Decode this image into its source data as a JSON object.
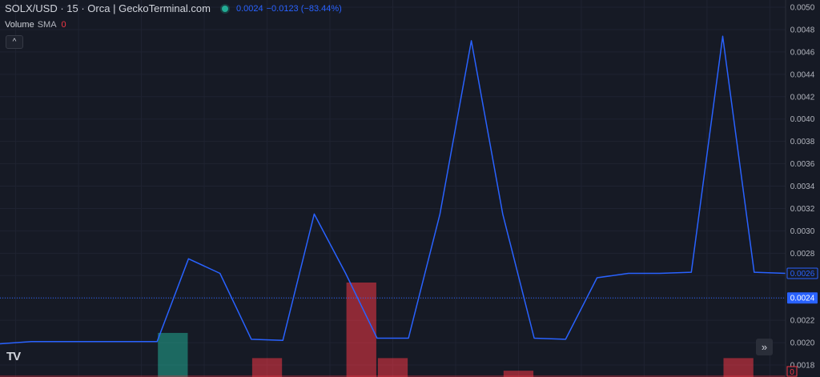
{
  "legend": {
    "title": "SOLX/USD · 15 · Orca | GeckoTerminal.com",
    "price": "0.0024",
    "change": "−0.0123 (−83.44%)",
    "volume_label": "Volume",
    "volume_sma_label": "SMA",
    "volume_value": "0"
  },
  "controls": {
    "collapse_symbol": "^",
    "scroll_symbol": "»",
    "logo_text": "TV"
  },
  "colors": {
    "background": "#161a25",
    "line": "#2962ff",
    "volume_up": "#22ab94",
    "volume_down": "#f23645",
    "grid": "#1f2331"
  },
  "chart_data": {
    "type": "line",
    "title": "",
    "xlabel": "",
    "ylabel": "",
    "ylim": [
      0.0017,
      0.005
    ],
    "y_ticks": [
      "0.0050",
      "0.0048",
      "0.0046",
      "0.0044",
      "0.0042",
      "0.0040",
      "0.0038",
      "0.0036",
      "0.0034",
      "0.0032",
      "0.0030",
      "0.0028",
      "0.0026",
      "0.0024",
      "0.0022",
      "0.0020",
      "0.0018"
    ],
    "grid": true,
    "price_series": [
      0.00199,
      0.00201,
      0.00201,
      0.00201,
      0.00201,
      0.00201,
      0.00275,
      0.00262,
      0.00203,
      0.00202,
      0.00315,
      0.00262,
      0.00204,
      0.00204,
      0.00315,
      0.0047,
      0.00315,
      0.00204,
      0.00203,
      0.00258,
      0.00262,
      0.00262,
      0.00263,
      0.00474,
      0.00263,
      0.00262
    ],
    "volume_bars": [
      {
        "index": 5.5,
        "value": 0.14,
        "direction": "up"
      },
      {
        "index": 8.5,
        "value": 0.06,
        "direction": "down"
      },
      {
        "index": 11.5,
        "value": 0.3,
        "direction": "down"
      },
      {
        "index": 12.5,
        "value": 0.06,
        "direction": "down"
      },
      {
        "index": 16.5,
        "value": 0.02,
        "direction": "down"
      },
      {
        "index": 23.5,
        "value": 0.06,
        "direction": "down"
      }
    ],
    "last_price_label": "0.0026",
    "current_price_label": "0.0024",
    "current_price": 0.0024,
    "volume_scale_label": "0"
  }
}
